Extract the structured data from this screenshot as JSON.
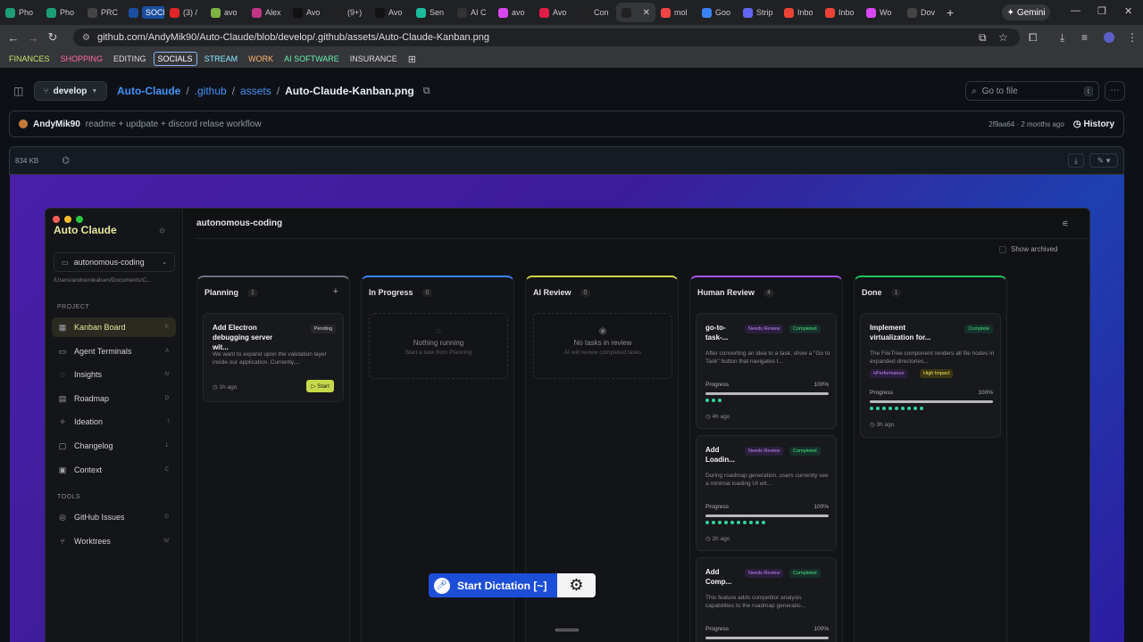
{
  "browser": {
    "tabs": [
      "Pho",
      "Pho",
      "PRC",
      "SOCIALS",
      "(3) /",
      "avo",
      "Alex",
      "Avo",
      "(9+)",
      "Avo",
      "Sen",
      "AI C",
      "avo",
      "Avo",
      "Con",
      "",
      "mol",
      "Goo",
      "Strip",
      "Inbo",
      "Inbo",
      "Wo",
      "Dov"
    ],
    "gemini_label": "Gemini",
    "url": "github.com/AndyMik90/Auto-Claude/blob/develop/.github/assets/Auto-Claude-Kanban.png",
    "bookmarks": [
      {
        "label": "FINANCES",
        "color": "#c8e06a"
      },
      {
        "label": "SHOPPING",
        "color": "#ff6b9d"
      },
      {
        "label": "EDITING",
        "color": "#dddddd"
      },
      {
        "label": "SOCIALS",
        "color": "#ffffff",
        "highlight": true
      },
      {
        "label": "STREAM",
        "color": "#8be9fd"
      },
      {
        "label": "WORK",
        "color": "#ffb86c"
      },
      {
        "label": "AI SOFTWARE",
        "color": "#69f0ae"
      },
      {
        "label": "INSURANCE",
        "color": "#dddddd"
      }
    ]
  },
  "github": {
    "branch": "develop",
    "breadcrumbs": [
      "Auto-Claude",
      ".github",
      "assets"
    ],
    "filename": "Auto-Claude-Kanban.png",
    "goto_placeholder": "Go to file",
    "goto_key": "t",
    "commit_author": "AndyMik90",
    "commit_message": "readme + updpate + discord relase workflow",
    "commit_meta": "2f9aa64 · 2 months ago",
    "history_label": "History",
    "file_size": "834 KB"
  },
  "app": {
    "title": "Auto Claude",
    "project": "autonomous-coding",
    "project_path": "/Users/andremikalsen/Documents/C...",
    "header_title": "autonomous-coding",
    "show_archived": "Show archived",
    "section_project": "PROJECT",
    "section_tools": "TOOLS",
    "nav": [
      {
        "label": "Kanban Board",
        "key": "K",
        "icon": "▦"
      },
      {
        "label": "Agent Terminals",
        "key": "A",
        "icon": "▭"
      },
      {
        "label": "Insights",
        "key": "N",
        "icon": "◌"
      },
      {
        "label": "Roadmap",
        "key": "D",
        "icon": "▤"
      },
      {
        "label": "Ideation",
        "key": "I",
        "icon": "✧"
      },
      {
        "label": "Changelog",
        "key": "L",
        "icon": "▢"
      },
      {
        "label": "Context",
        "key": "C",
        "icon": "▣"
      }
    ],
    "tools": [
      {
        "label": "GitHub Issues",
        "key": "G",
        "icon": "◎"
      },
      {
        "label": "Worktrees",
        "key": "W",
        "icon": "⑂"
      }
    ],
    "columns": [
      {
        "name": "Planning",
        "count": "1",
        "accent": "#6b7280"
      },
      {
        "name": "In Progress",
        "count": "0",
        "accent": "#3b82f6"
      },
      {
        "name": "AI Review",
        "count": "0",
        "accent": "#d4d44a"
      },
      {
        "name": "Human Review",
        "count": "4",
        "accent": "#a855f7"
      },
      {
        "name": "Done",
        "count": "1",
        "accent": "#22c55e"
      }
    ],
    "planning_card": {
      "title": "Add Electron debugging server wit...",
      "status": "Pending",
      "desc": "We want to expand upon the validation layer inside our application. Currently,...",
      "time": "1h ago",
      "start": "Start"
    },
    "in_progress_empty": {
      "title": "Nothing running",
      "sub": "Start a task from Planning"
    },
    "ai_review_empty": {
      "title": "No tasks in review",
      "sub": "AI will review completed tasks"
    },
    "review_cards": [
      {
        "title": "go-to-task-...",
        "badge1": "Needs Review",
        "badge2": "Completed",
        "desc": "After converting an idea to a task, show a \"Go to Task\" button that navigates t...",
        "progress_label": "Progress",
        "progress": "100%",
        "dots": 3,
        "time": "4h ago"
      },
      {
        "title": "Add Loadin...",
        "badge1": "Needs Review",
        "badge2": "Completed",
        "desc": "During roadmap generation, users currently see a minimal loading UI wit...",
        "progress_label": "Progress",
        "progress": "100%",
        "dots": 10,
        "time": "2h ago"
      },
      {
        "title": "Add Comp...",
        "badge1": "Needs Review",
        "badge2": "Completed",
        "desc": "This feature adds competitor analysis capabilities to the roadmap generatio...",
        "progress_label": "Progress",
        "progress": "100%",
        "dots": 0,
        "time": ""
      }
    ],
    "done_card": {
      "title": "Implement virtualization for...",
      "badge": "Complete",
      "desc": "The FileTree component renders all file nodes in expanded directories...",
      "tag1": "Performance",
      "tag2": "High Impact",
      "progress_label": "Progress",
      "progress": "100%",
      "dots": 9,
      "time": "3h ago"
    }
  },
  "dictation": {
    "label": "Start Dictation [~]"
  }
}
